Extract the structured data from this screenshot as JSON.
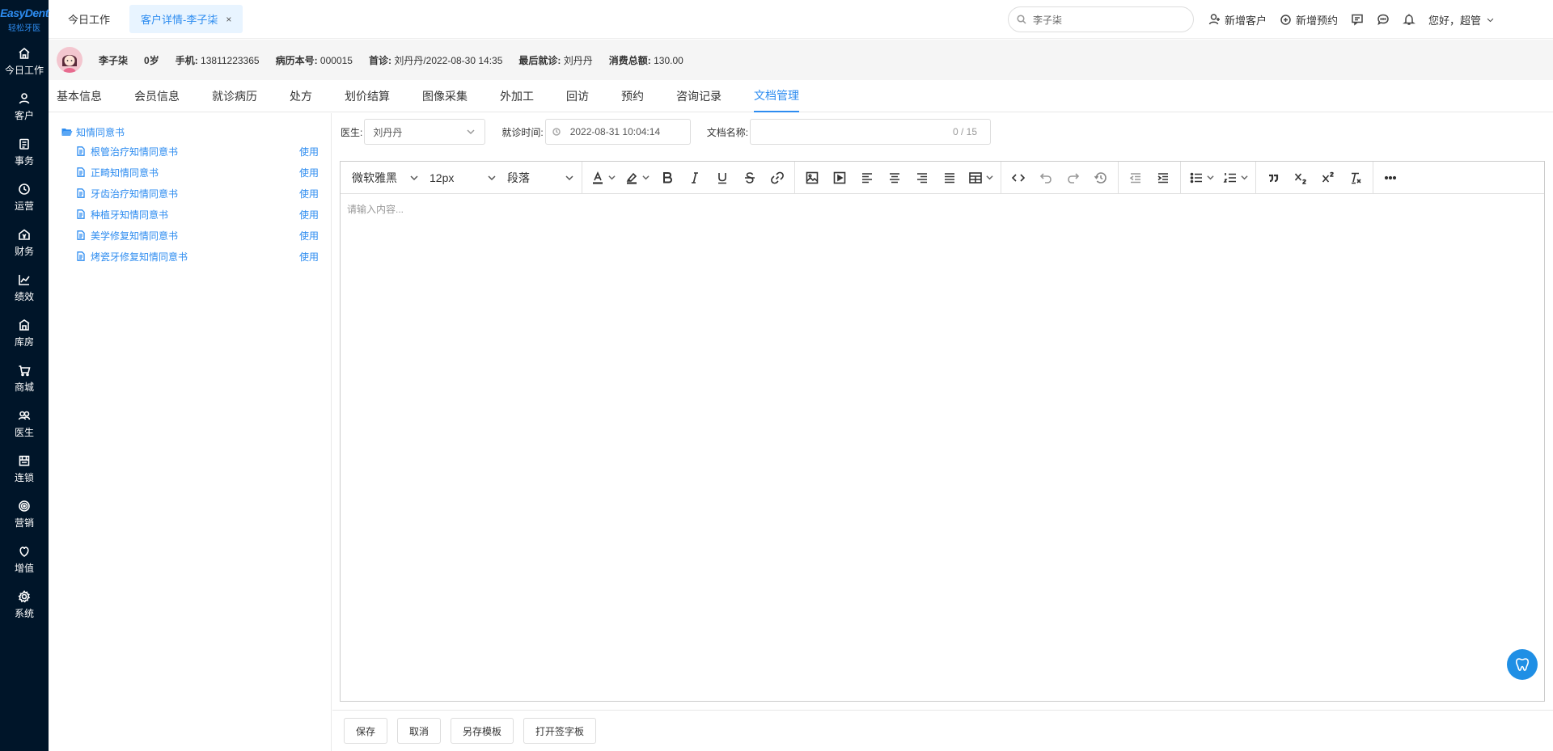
{
  "logo": {
    "brand": "EasyDent",
    "sub": "轻松牙医"
  },
  "sidebar": {
    "items": [
      {
        "label": "今日工作",
        "icon": "home-icon"
      },
      {
        "label": "客户",
        "icon": "user-icon"
      },
      {
        "label": "事务",
        "icon": "clipboard-icon"
      },
      {
        "label": "运营",
        "icon": "clock-icon"
      },
      {
        "label": "财务",
        "icon": "finance-icon"
      },
      {
        "label": "绩效",
        "icon": "chart-icon"
      },
      {
        "label": "库房",
        "icon": "warehouse-icon"
      },
      {
        "label": "商城",
        "icon": "cart-icon"
      },
      {
        "label": "医生",
        "icon": "doctor-icon"
      },
      {
        "label": "连锁",
        "icon": "chain-icon"
      },
      {
        "label": "营销",
        "icon": "target-icon"
      },
      {
        "label": "增值",
        "icon": "value-icon"
      },
      {
        "label": "系统",
        "icon": "gear-icon"
      }
    ]
  },
  "topbar": {
    "tab_today": "今日工作",
    "tab_active": "客户详情-李子柒",
    "tab_close": "×",
    "search_value": "李子柒",
    "new_customer": "新增客户",
    "new_appointment": "新增预约",
    "greeting": "您好，超管"
  },
  "patient": {
    "name": "李子柒",
    "age": "0岁",
    "phone_label": "手机:",
    "phone": "13811223365",
    "record_label": "病历本号:",
    "record": "000015",
    "first_label": "首诊:",
    "first": "刘丹丹/2022-08-30 14:35",
    "last_label": "最后就诊:",
    "last": "刘丹丹",
    "total_label": "消费总额:",
    "total": "130.00"
  },
  "tabs": [
    "基本信息",
    "会员信息",
    "就诊病历",
    "处方",
    "划价结算",
    "图像采集",
    "外加工",
    "回访",
    "预约",
    "咨询记录",
    "文档管理"
  ],
  "tree": {
    "folder": "知情同意书",
    "use_label": "使用",
    "docs": [
      "根管治疗知情同意书",
      "正畸知情同意书",
      "牙齿治疗知情同意书",
      "种植牙知情同意书",
      "美学修复知情同意书",
      "烤瓷牙修复知情同意书"
    ]
  },
  "form": {
    "doctor_label": "医生:",
    "doctor": "刘丹丹",
    "time_label": "就诊时间:",
    "time": "2022-08-31 10:04:14",
    "docname_label": "文档名称:",
    "docname_count": "0 / 15"
  },
  "editor": {
    "font": "微软雅黑",
    "size": "12px",
    "block": "段落",
    "placeholder": "请输入内容..."
  },
  "actions": {
    "save": "保存",
    "cancel": "取消",
    "save_template": "另存模板",
    "open_sign": "打开签字板"
  }
}
